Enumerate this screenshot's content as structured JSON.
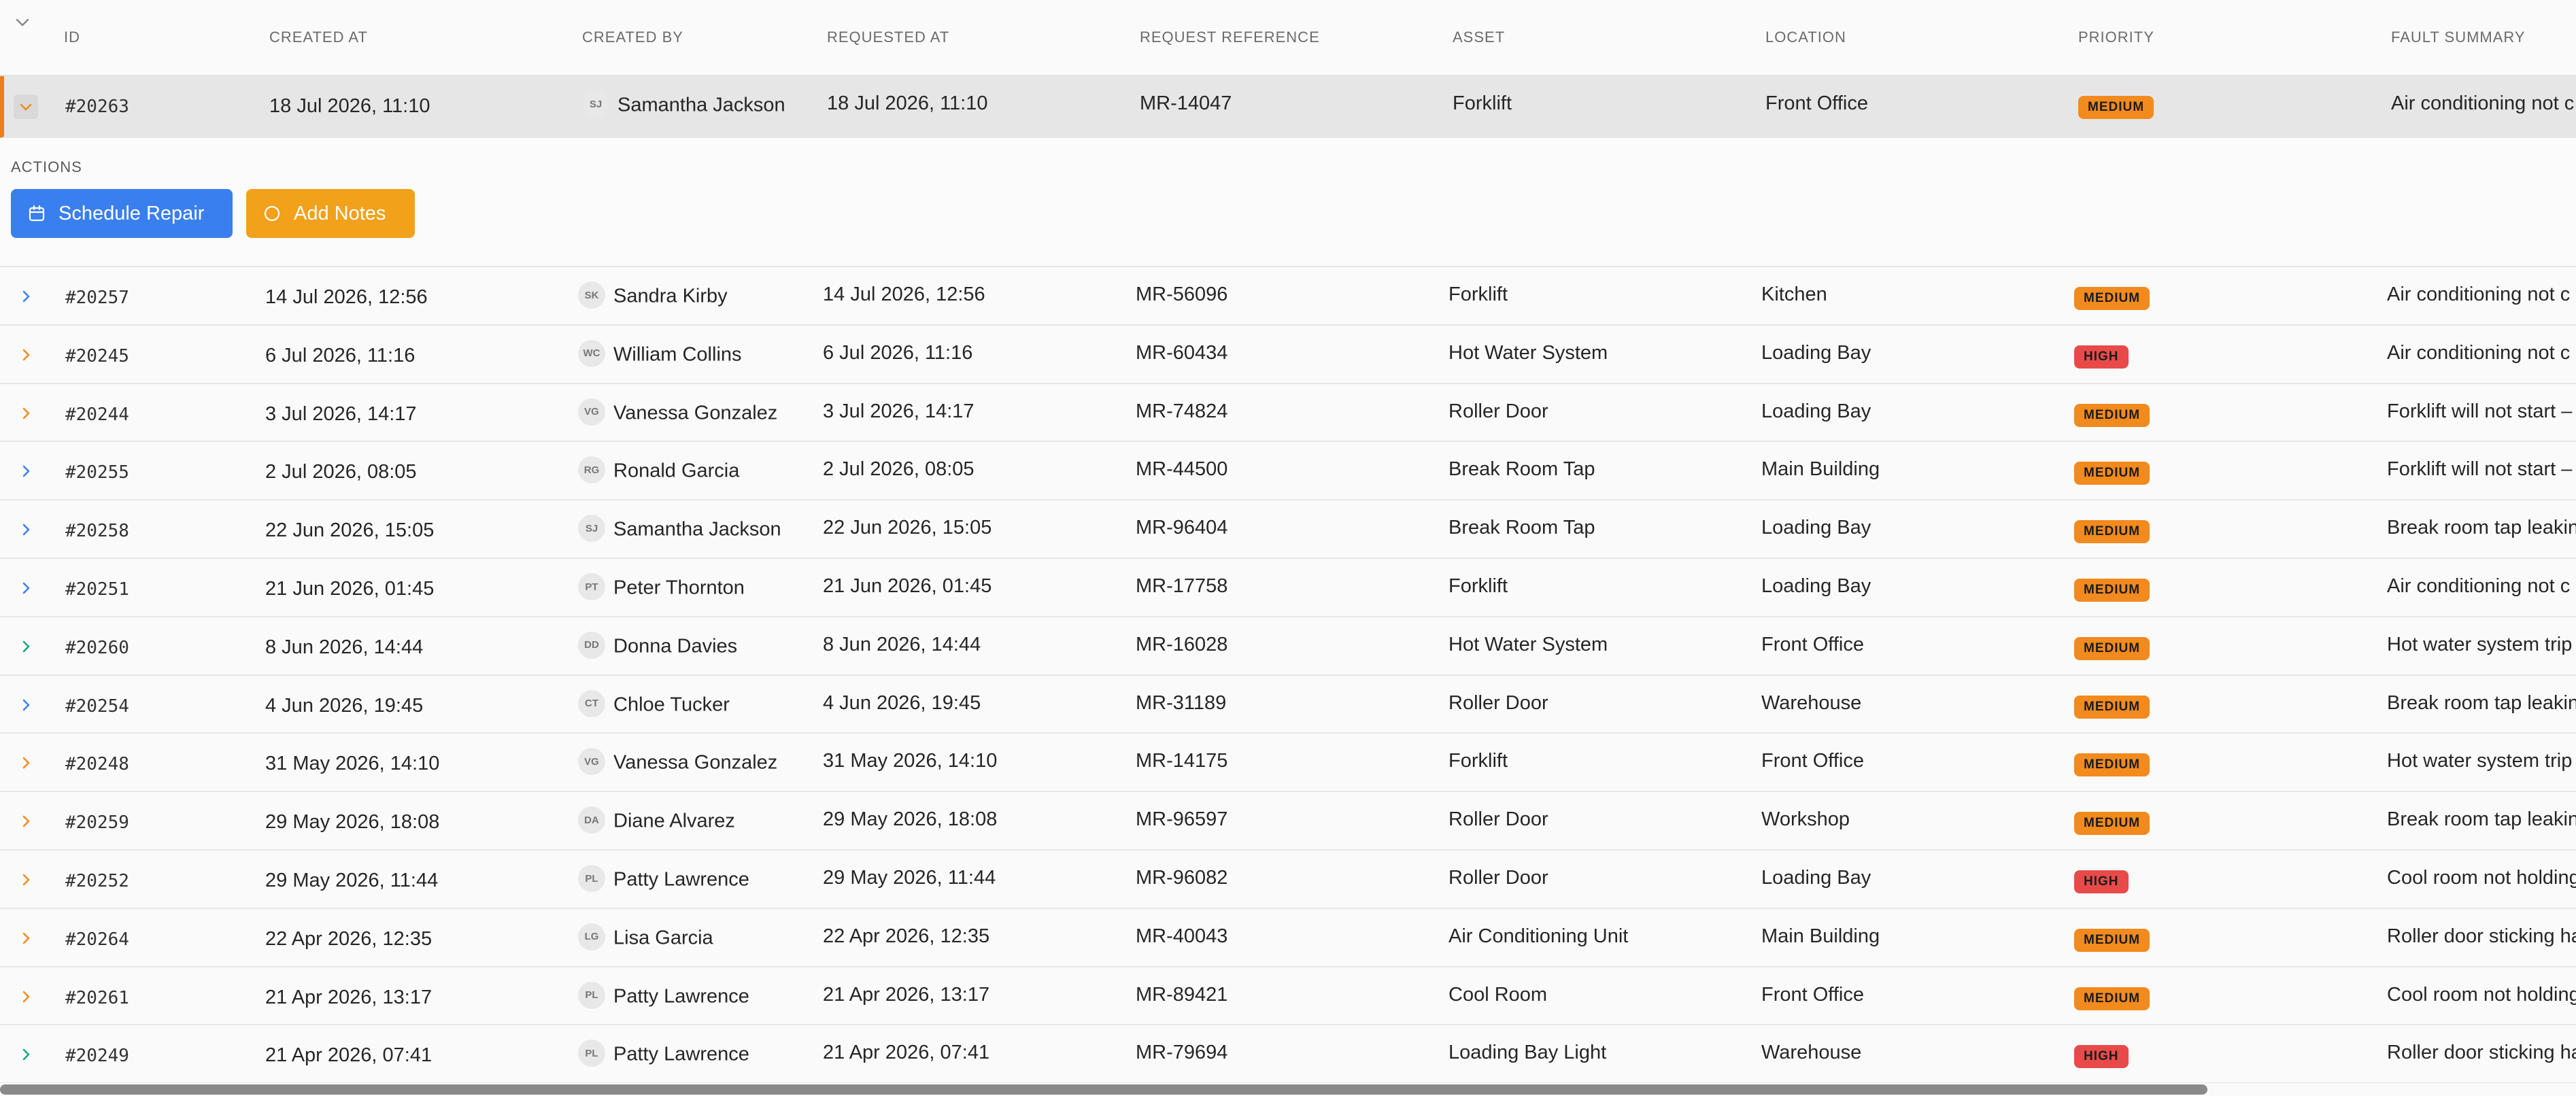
{
  "headers": {
    "id": "ID",
    "created_at": "CREATED AT",
    "created_by": "CREATED BY",
    "requested_at": "REQUESTED AT",
    "request_reference": "REQUEST REFERENCE",
    "asset": "ASSET",
    "location": "LOCATION",
    "priority": "PRIORITY",
    "fault_summary": "FAULT SUMMARY"
  },
  "expanded_row": {
    "id": "#20263",
    "created_at": "18 Jul 2026, 11:10",
    "initials": "SJ",
    "created_by": "Samantha Jackson",
    "requested_at": "18 Jul 2026, 11:10",
    "reference": "MR-14047",
    "asset": "Forklift",
    "location": "Front Office",
    "priority": "MEDIUM",
    "fault": "Air conditioning not c",
    "chevron_color": "#f28a1e"
  },
  "actions": {
    "label": "ACTIONS",
    "schedule_repair": "Schedule Repair",
    "add_notes": "Add Notes"
  },
  "rows": [
    {
      "id": "#20257",
      "created_at": "14 Jul 2026, 12:56",
      "initials": "SK",
      "created_by": "Sandra Kirby",
      "requested_at": "14 Jul 2026, 12:56",
      "reference": "MR-56096",
      "asset": "Forklift",
      "location": "Kitchen",
      "priority": "MEDIUM",
      "fault": "Air conditioning not c",
      "chevron_color": "#3a7fee"
    },
    {
      "id": "#20245",
      "created_at": "6 Jul 2026, 11:16",
      "initials": "WC",
      "created_by": "William Collins",
      "requested_at": "6 Jul 2026, 11:16",
      "reference": "MR-60434",
      "asset": "Hot Water System",
      "location": "Loading Bay",
      "priority": "HIGH",
      "fault": "Air conditioning not c",
      "chevron_color": "#f28a1e"
    },
    {
      "id": "#20244",
      "created_at": "3 Jul 2026, 14:17",
      "initials": "VG",
      "created_by": "Vanessa Gonzalez",
      "requested_at": "3 Jul 2026, 14:17",
      "reference": "MR-74824",
      "asset": "Roller Door",
      "location": "Loading Bay",
      "priority": "MEDIUM",
      "fault": "Forklift will not start –",
      "chevron_color": "#f28a1e"
    },
    {
      "id": "#20255",
      "created_at": "2 Jul 2026, 08:05",
      "initials": "RG",
      "created_by": "Ronald Garcia",
      "requested_at": "2 Jul 2026, 08:05",
      "reference": "MR-44500",
      "asset": "Break Room Tap",
      "location": "Main Building",
      "priority": "MEDIUM",
      "fault": "Forklift will not start –",
      "chevron_color": "#3a7fee"
    },
    {
      "id": "#20258",
      "created_at": "22 Jun 2026, 15:05",
      "initials": "SJ",
      "created_by": "Samantha Jackson",
      "requested_at": "22 Jun 2026, 15:05",
      "reference": "MR-96404",
      "asset": "Break Room Tap",
      "location": "Loading Bay",
      "priority": "MEDIUM",
      "fault": "Break room tap leakin",
      "chevron_color": "#3a7fee"
    },
    {
      "id": "#20251",
      "created_at": "21 Jun 2026, 01:45",
      "initials": "PT",
      "created_by": "Peter Thornton",
      "requested_at": "21 Jun 2026, 01:45",
      "reference": "MR-17758",
      "asset": "Forklift",
      "location": "Loading Bay",
      "priority": "MEDIUM",
      "fault": "Air conditioning not c",
      "chevron_color": "#3a7fee"
    },
    {
      "id": "#20260",
      "created_at": "8 Jun 2026, 14:44",
      "initials": "DD",
      "created_by": "Donna Davies",
      "requested_at": "8 Jun 2026, 14:44",
      "reference": "MR-16028",
      "asset": "Hot Water System",
      "location": "Front Office",
      "priority": "MEDIUM",
      "fault": "Hot water system trip",
      "chevron_color": "#1aa37a"
    },
    {
      "id": "#20254",
      "created_at": "4 Jun 2026, 19:45",
      "initials": "CT",
      "created_by": "Chloe Tucker",
      "requested_at": "4 Jun 2026, 19:45",
      "reference": "MR-31189",
      "asset": "Roller Door",
      "location": "Warehouse",
      "priority": "MEDIUM",
      "fault": "Break room tap leakin",
      "chevron_color": "#3a7fee"
    },
    {
      "id": "#20248",
      "created_at": "31 May 2026, 14:10",
      "initials": "VG",
      "created_by": "Vanessa Gonzalez",
      "requested_at": "31 May 2026, 14:10",
      "reference": "MR-14175",
      "asset": "Forklift",
      "location": "Front Office",
      "priority": "MEDIUM",
      "fault": "Hot water system trip",
      "chevron_color": "#f28a1e"
    },
    {
      "id": "#20259",
      "created_at": "29 May 2026, 18:08",
      "initials": "DA",
      "created_by": "Diane Alvarez",
      "requested_at": "29 May 2026, 18:08",
      "reference": "MR-96597",
      "asset": "Roller Door",
      "location": "Workshop",
      "priority": "MEDIUM",
      "fault": "Break room tap leakin",
      "chevron_color": "#f28a1e"
    },
    {
      "id": "#20252",
      "created_at": "29 May 2026, 11:44",
      "initials": "PL",
      "created_by": "Patty Lawrence",
      "requested_at": "29 May 2026, 11:44",
      "reference": "MR-96082",
      "asset": "Roller Door",
      "location": "Loading Bay",
      "priority": "HIGH",
      "fault": "Cool room not holding",
      "chevron_color": "#f28a1e"
    },
    {
      "id": "#20264",
      "created_at": "22 Apr 2026, 12:35",
      "initials": "LG",
      "created_by": "Lisa Garcia",
      "requested_at": "22 Apr 2026, 12:35",
      "reference": "MR-40043",
      "asset": "Air Conditioning Unit",
      "location": "Main Building",
      "priority": "MEDIUM",
      "fault": "Roller door sticking ha",
      "chevron_color": "#f28a1e"
    },
    {
      "id": "#20261",
      "created_at": "21 Apr 2026, 13:17",
      "initials": "PL",
      "created_by": "Patty Lawrence",
      "requested_at": "21 Apr 2026, 13:17",
      "reference": "MR-89421",
      "asset": "Cool Room",
      "location": "Front Office",
      "priority": "MEDIUM",
      "fault": "Cool room not holding",
      "chevron_color": "#f28a1e"
    },
    {
      "id": "#20249",
      "created_at": "21 Apr 2026, 07:41",
      "initials": "PL",
      "created_by": "Patty Lawrence",
      "requested_at": "21 Apr 2026, 07:41",
      "reference": "MR-79694",
      "asset": "Loading Bay Light",
      "location": "Warehouse",
      "priority": "HIGH",
      "fault": "Roller door sticking ha",
      "chevron_color": "#1aa37a"
    }
  ]
}
